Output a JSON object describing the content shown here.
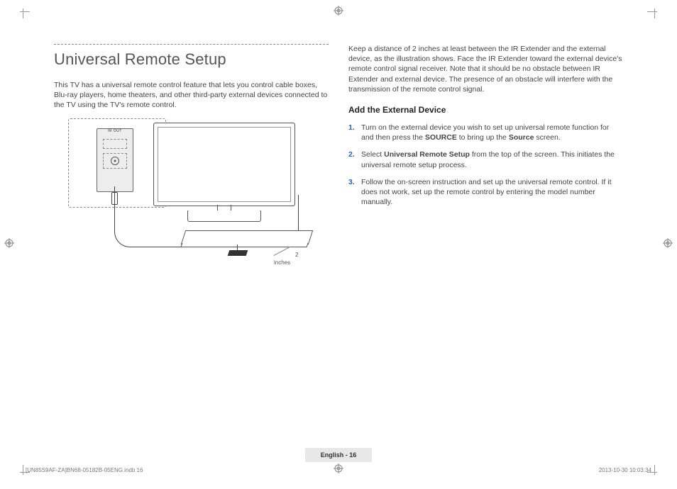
{
  "title": "Universal Remote Setup",
  "intro": "This TV has a universal remote control feature that lets you control cable boxes, Blu-ray players, home theaters, and other third-party external devices connected to the TV using the TV's remote control.",
  "diagram": {
    "ir_out_label": "IR OUT",
    "distance_label": "2 inches"
  },
  "right_intro_parts": {
    "a": "Keep a distance of 2 inches at least between the IR Extender and the external device, as the illustration shows. Face the IR Extender toward the external device's remote control signal receiver. Note that it should be no obstacle between IR Extender and external device. The presence of an obstacle will interfere with the transmission of the remote control signal."
  },
  "section_heading": "Add the External Device",
  "steps": {
    "s1": {
      "a": "Turn on the external device you wish to set up universal remote function for and then press the ",
      "b": "SOURCE",
      "c": " to bring up the ",
      "d": "Source",
      "e": " screen."
    },
    "s2": {
      "a": "Select ",
      "b": "Universal Remote Setup",
      "c": " from the top of the screen. This initiates the universal remote setup process."
    },
    "s3": {
      "a": "Follow the on-screen instruction and set up the universal remote control. If it does not work, set up the remote control by entering the model number manually."
    }
  },
  "footer": {
    "page_label": "English - 16",
    "slug_left": "[UN85S9AF-ZA]BN68-05182B-05ENG.indb   16",
    "slug_right": "2013-10-30      10:03:34"
  }
}
